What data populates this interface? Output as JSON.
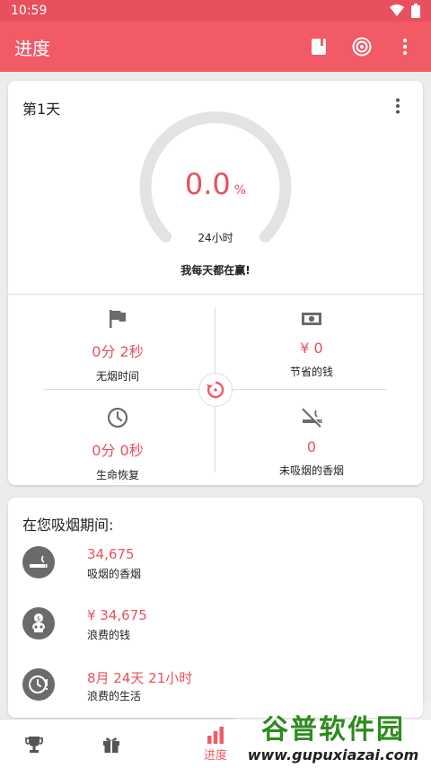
{
  "status_bar": {
    "time": "10:59"
  },
  "app_bar": {
    "title": "进度"
  },
  "progress_card": {
    "day_label": "第1天",
    "percent_value": "0.0",
    "percent_unit": "%",
    "percent_fraction": 0.0,
    "gauge_subtitle": "24小时",
    "motto": "我每天都在赢!",
    "stats": [
      {
        "value": "0分 2秒",
        "label": "无烟时间",
        "icon": "flag-icon"
      },
      {
        "value": "¥ 0",
        "label": "节省的钱",
        "icon": "money-icon"
      },
      {
        "value": "0分 0秒",
        "label": "生命恢复",
        "icon": "clock-icon"
      },
      {
        "value": "0",
        "label": "未吸烟的香烟",
        "icon": "no-smoking-icon"
      }
    ]
  },
  "during_smoking": {
    "title": "在您吸烟期间:",
    "rows": [
      {
        "value": "34,675",
        "label": "吸烟的香烟",
        "icon": "cigarette-icon"
      },
      {
        "value": "¥ 34,675",
        "label": "浪费的钱",
        "icon": "skull-money-icon"
      },
      {
        "value": "8月 24天 21小时",
        "label": "浪费的生活",
        "icon": "clock-alert-icon"
      }
    ]
  },
  "bottom_nav": {
    "active_label": "进度"
  },
  "watermark": {
    "title": "谷普软件园",
    "url": "www.gupuxiazai.com"
  },
  "colors": {
    "accent": "#F25A66",
    "value": "#E8505E",
    "icon_gray": "#6B6B6B"
  }
}
